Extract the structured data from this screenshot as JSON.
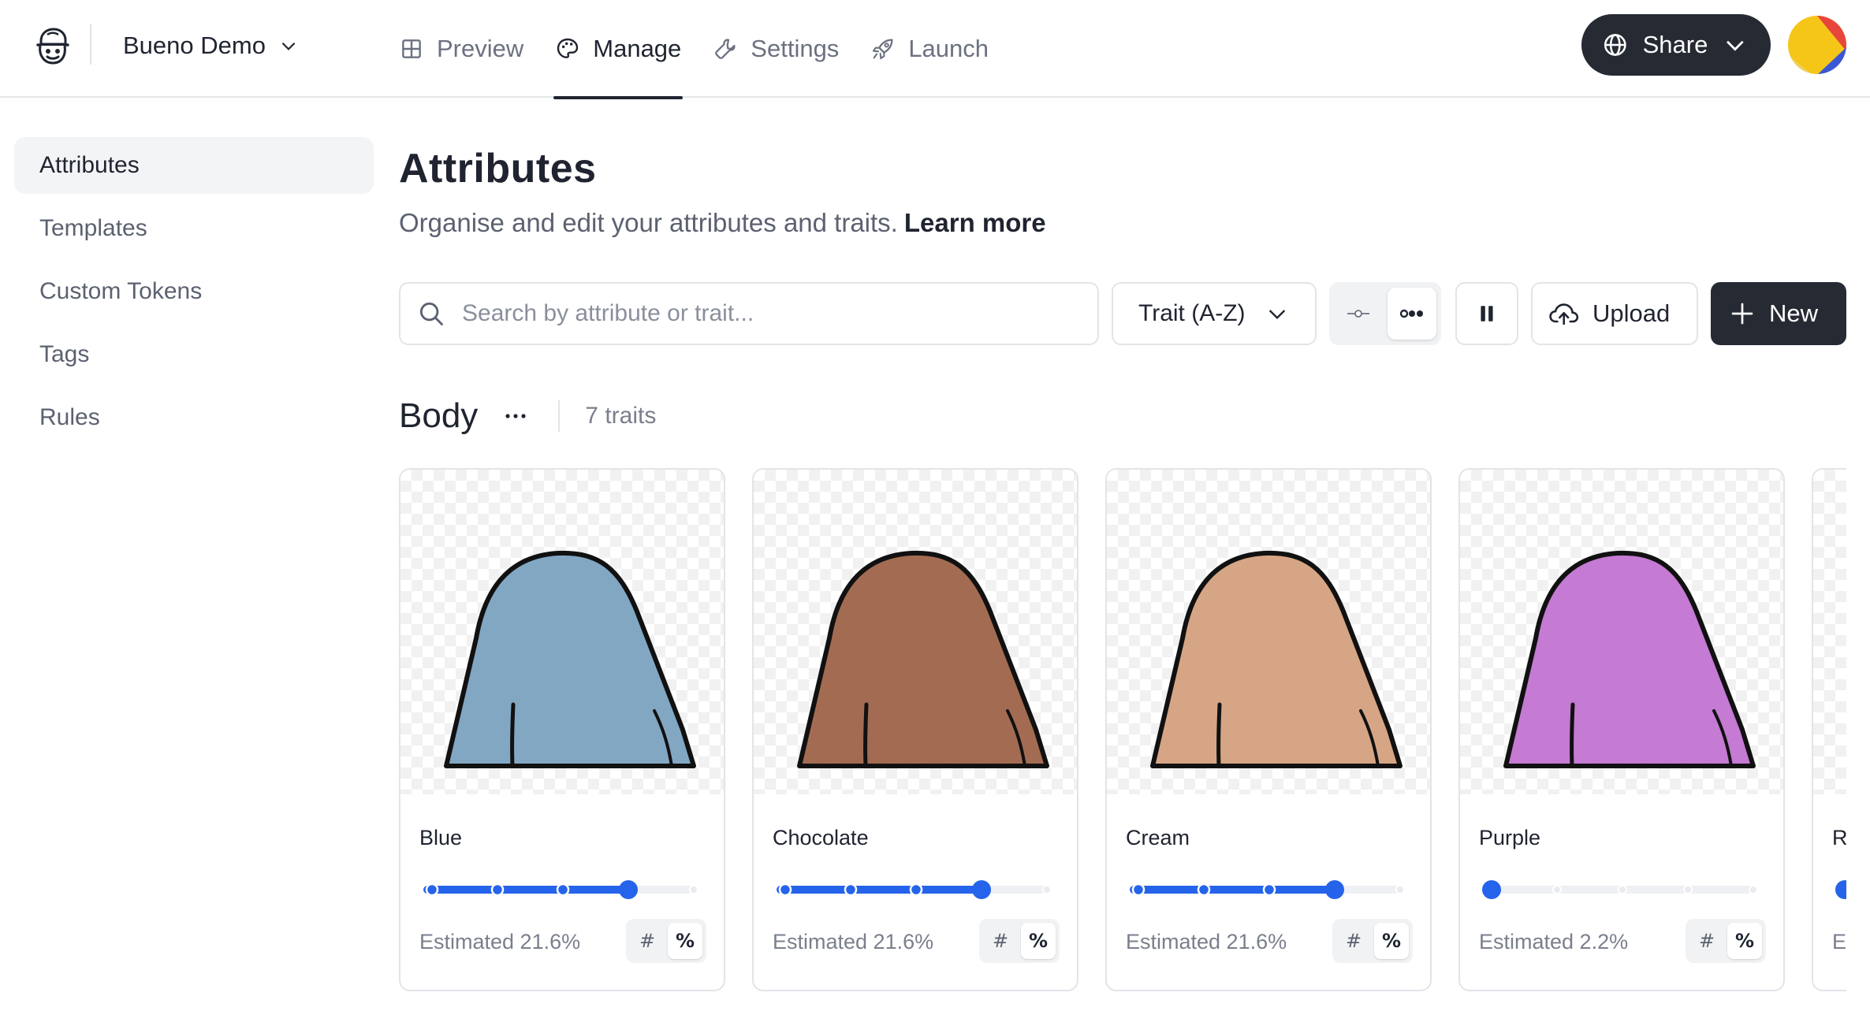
{
  "header": {
    "project_name": "Bueno Demo",
    "nav": [
      {
        "label": "Preview",
        "icon": "grid-icon",
        "active": false
      },
      {
        "label": "Manage",
        "icon": "palette-icon",
        "active": true
      },
      {
        "label": "Settings",
        "icon": "wrench-icon",
        "active": false
      },
      {
        "label": "Launch",
        "icon": "rocket-icon",
        "active": false
      }
    ],
    "share_label": "Share"
  },
  "sidebar": {
    "items": [
      {
        "label": "Attributes",
        "active": true
      },
      {
        "label": "Templates",
        "active": false
      },
      {
        "label": "Custom Tokens",
        "active": false
      },
      {
        "label": "Tags",
        "active": false
      },
      {
        "label": "Rules",
        "active": false
      }
    ]
  },
  "main": {
    "title": "Attributes",
    "subtitle": "Organise and edit your attributes and traits.",
    "learn_more": "Learn more",
    "search_placeholder": "Search by attribute or trait...",
    "sort_label": "Trait (A-Z)",
    "upload_label": "Upload",
    "new_label": "New",
    "group": {
      "name": "Body",
      "count_label": "7 traits"
    },
    "traits": [
      {
        "name": "Blue",
        "estimate": "Estimated 21.6%",
        "rarity_level": 3,
        "color": "#82a7c3"
      },
      {
        "name": "Chocolate",
        "estimate": "Estimated 21.6%",
        "rarity_level": 3,
        "color": "#a36c52"
      },
      {
        "name": "Cream",
        "estimate": "Estimated 21.6%",
        "rarity_level": 3,
        "color": "#d6a585"
      },
      {
        "name": "Purple",
        "estimate": "Estimated 2.2%",
        "rarity_level": 0,
        "color": "#c57ad3"
      },
      {
        "name": "R",
        "estimate": "E",
        "rarity_level": 0,
        "color": "#82a7c3"
      }
    ],
    "unit_options": [
      "#",
      "%"
    ],
    "unit_selected": "%"
  },
  "colors": {
    "accent": "#2563eb",
    "dark": "#262a33"
  }
}
